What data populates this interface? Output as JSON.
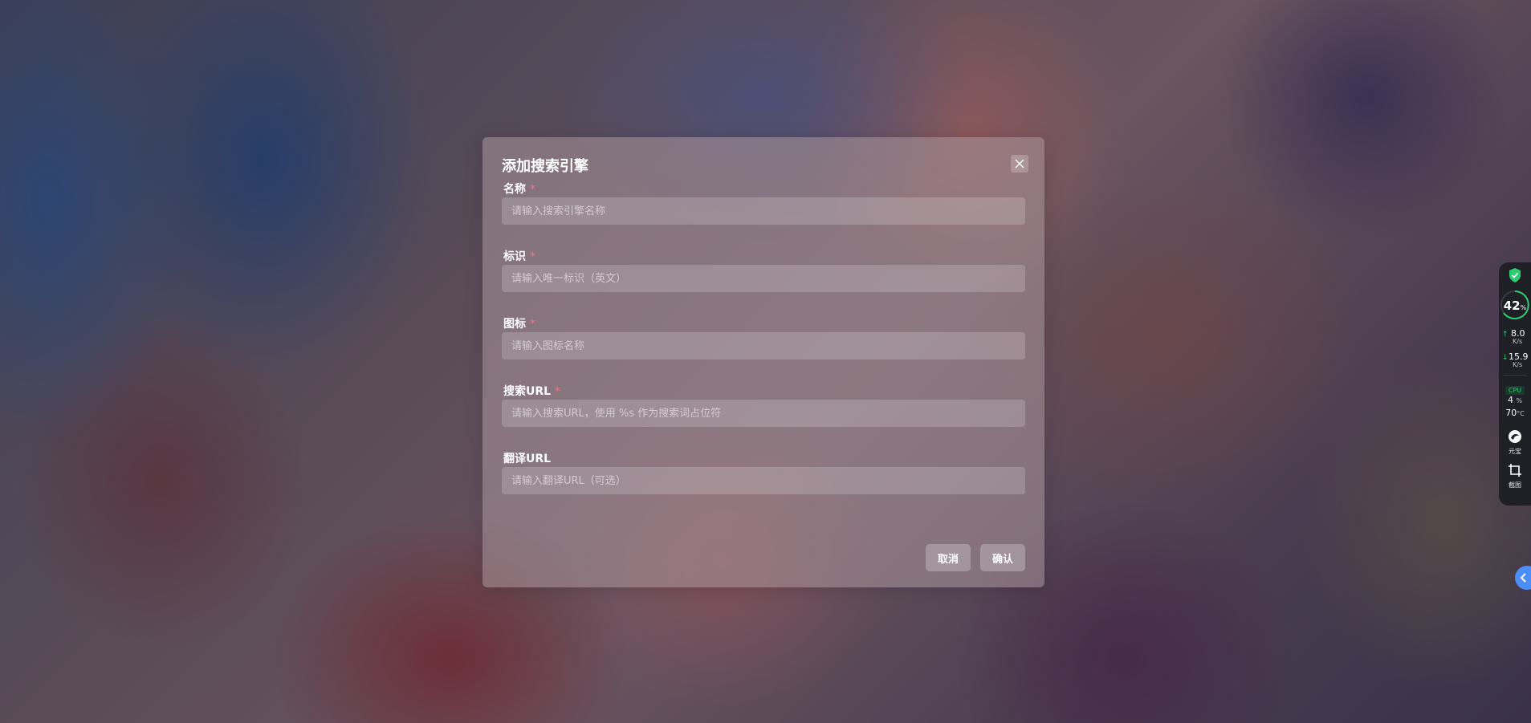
{
  "dialog": {
    "title": "添加搜索引擎",
    "required_mark": "*",
    "fields": [
      {
        "label": "名称",
        "required": true,
        "placeholder": "请输入搜索引擎名称",
        "value": ""
      },
      {
        "label": "标识",
        "required": true,
        "placeholder": "请输入唯一标识（英文）",
        "value": ""
      },
      {
        "label": "图标",
        "required": true,
        "placeholder": "请输入图标名称",
        "value": ""
      },
      {
        "label": "搜索URL",
        "required": true,
        "placeholder": "请输入搜索URL，使用 %s 作为搜索词占位符",
        "value": ""
      },
      {
        "label": "翻译URL",
        "required": false,
        "placeholder": "请输入翻译URL（可选）",
        "value": ""
      }
    ],
    "cancel_label": "取消",
    "confirm_label": "确认",
    "close_icon": "close-icon"
  },
  "system_widget": {
    "usage_value": "42",
    "usage_unit": "%",
    "upload_value": "8.0",
    "upload_unit": "K/s",
    "download_value": "15.9",
    "download_unit": "K/s",
    "cpu_label": "CPU",
    "cpu_usage": "4",
    "cpu_usage_unit": "%",
    "cpu_temp": "70",
    "cpu_temp_unit": "°C",
    "tool1_label": "元宝",
    "tool2_label": "截图",
    "accent_color": "#2ecc71"
  },
  "collapse_button_icon": "chevron-left-icon"
}
